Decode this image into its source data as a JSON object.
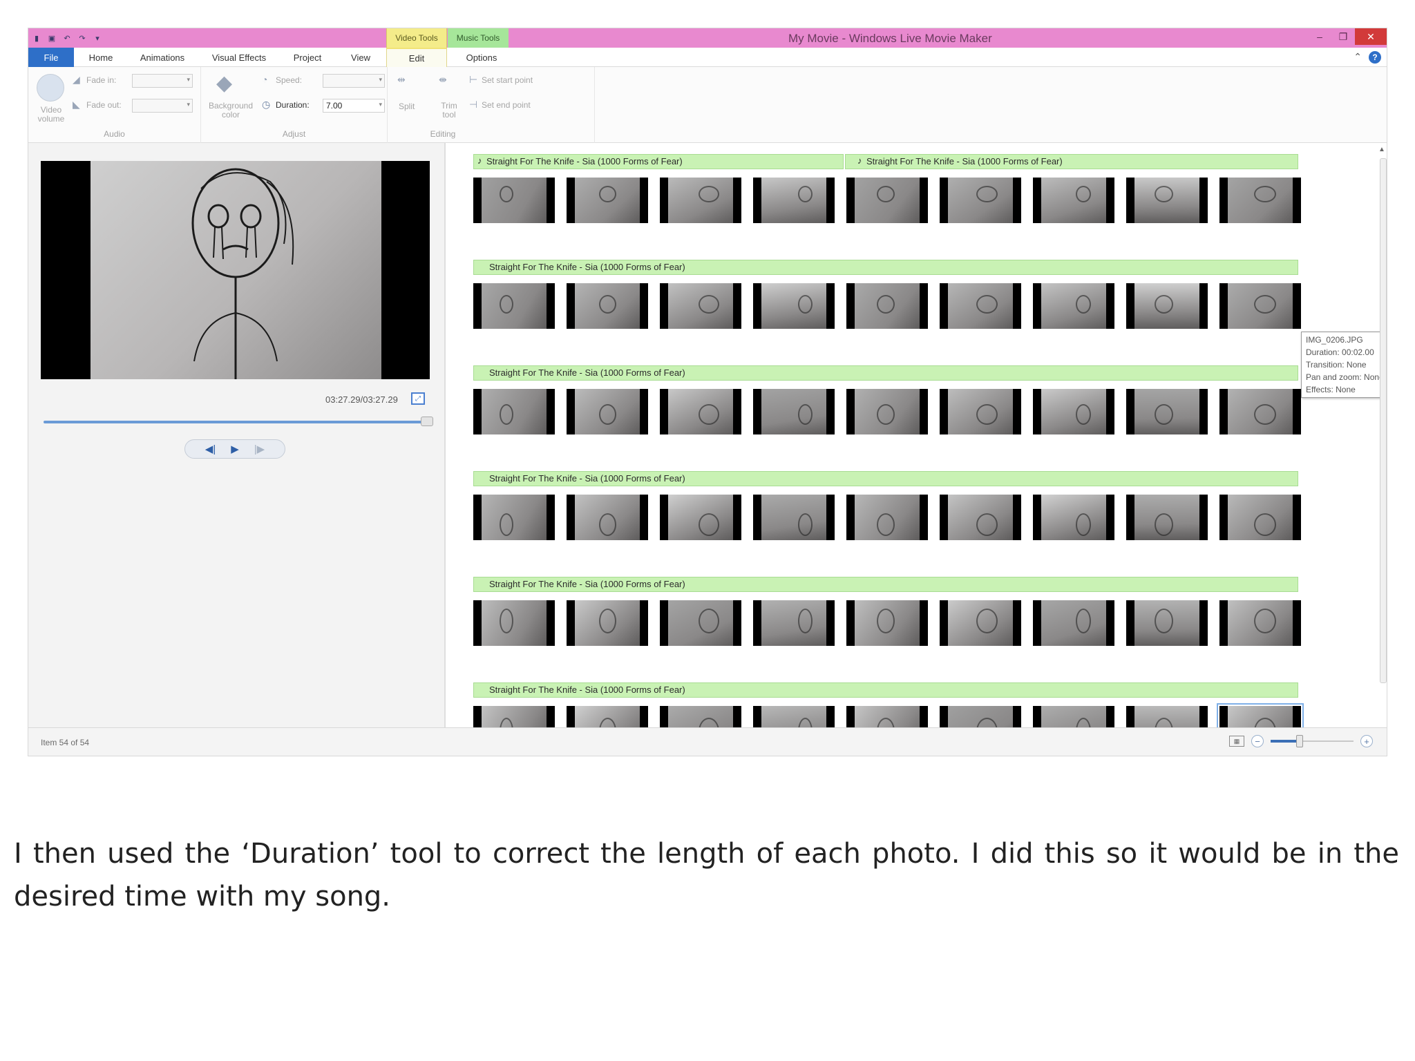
{
  "window": {
    "title": "My Movie - Windows Live Movie Maker",
    "contextual_tabs": [
      "Video Tools",
      "Music Tools"
    ]
  },
  "tabs": [
    "File",
    "Home",
    "Animations",
    "Visual Effects",
    "Project",
    "View",
    "Edit",
    "Options"
  ],
  "active_tab": "Edit",
  "ribbon": {
    "audio": {
      "label": "Audio",
      "video_volume": "Video volume",
      "fade_in": "Fade in:",
      "fade_out": "Fade out:"
    },
    "adjust": {
      "label": "Adjust",
      "background_color": "Background color",
      "speed": "Speed:",
      "duration_label": "Duration:",
      "duration_value": "7.00"
    },
    "editing": {
      "label": "Editing",
      "split": "Split",
      "trim_tool": "Trim tool",
      "set_start_point": "Set start point",
      "set_end_point": "Set end point"
    }
  },
  "preview": {
    "timecode": "03:27.29/03:27.29",
    "progress": 1.0
  },
  "storyboard": {
    "music_first": "Straight For The Knife - Sia (1000 Forms of Fear)",
    "music_second": "Straight For The Knife - Sia (1000 Forms of Fear)",
    "music_row": "Straight For The Knife - Sia (1000 Forms of Fear)",
    "rows": 6,
    "thumbs_per_row": 9
  },
  "tooltip": {
    "filename": "IMG_0206.JPG",
    "duration": "Duration: 00:02.00",
    "transition": "Transition: None",
    "pan_zoom": "Pan and zoom: None",
    "effects": "Effects: None"
  },
  "status": {
    "item_count": "Item 54 of 54",
    "zoom_level": 0.35
  },
  "caption": "I then used the ‘Duration’ tool to correct the length of each photo. I did this so it would be in the desired time with my song.",
  "colors": {
    "titlebar": "#e889cf",
    "video_tools": "#f4ec8a",
    "music_tools": "#a6e69a",
    "file_tab": "#2e6fc8",
    "music_bar": "#c9f2b4"
  }
}
